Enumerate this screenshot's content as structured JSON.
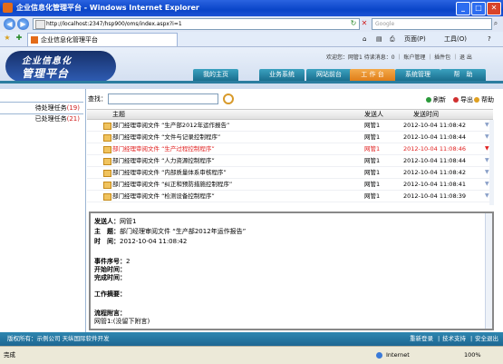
{
  "window": {
    "title": "企业信息化管理平台 - Windows Internet Explorer",
    "min": "_",
    "max": "□",
    "close": "✕"
  },
  "browser": {
    "url": "http://localhost:2347/hsp900/oms/index.aspx?i=1",
    "search_placeholder": "Google",
    "tab_title": "企业信息化管理平台",
    "toolbar": {
      "page": "页面(P)",
      "tools": "工具(O)",
      "help": "?"
    }
  },
  "app": {
    "logo_line1": "企业信息化",
    "logo_line2": "管理平台",
    "welcome": "欢迎您：网管1 待读消息：0 ｜ 账户管理 ｜ 插件包 ｜ 退 出",
    "nav": [
      "我的主页",
      "业务系统",
      "网站前台",
      "工 作 台",
      "系统管理",
      "帮　助"
    ]
  },
  "left_panel": {
    "items": [
      {
        "label": "待处理任务",
        "count": "(19)"
      },
      {
        "label": "已处理任务",
        "count": "(21)"
      }
    ]
  },
  "content": {
    "search_label": "查找：",
    "tools": [
      "刷新",
      "导出",
      "帮助"
    ],
    "columns": [
      "主题",
      "发送人",
      "发送时间"
    ],
    "rows": [
      {
        "subject": "部门经理审阅文件 “生产部2012年运作报告”",
        "sender": "网管1",
        "time": "2012-10-04 11:08:42",
        "highlight": false
      },
      {
        "subject": "部门经理审阅文件 “文件与记录控制程序”",
        "sender": "网管1",
        "time": "2012-10-04 11:08:44",
        "highlight": false
      },
      {
        "subject": "部门经理审阅文件 “生产过程控制程序”",
        "sender": "网管1",
        "time": "2012-10-04 11:08:46",
        "highlight": true
      },
      {
        "subject": "部门经理审阅文件 “人力资源控制程序”",
        "sender": "网管1",
        "time": "2012-10-04 11:08:44",
        "highlight": false
      },
      {
        "subject": "部门经理审阅文件 “内部质量体系审核程序”",
        "sender": "网管1",
        "time": "2012-10-04 11:08:42",
        "highlight": false
      },
      {
        "subject": "部门经理审阅文件 “纠正和预防措施控制程序”",
        "sender": "网管1",
        "time": "2012-10-04 11:08:41",
        "highlight": false
      },
      {
        "subject": "部门经理审阅文件 “检测设备控制程序”",
        "sender": "网管1",
        "time": "2012-10-04 11:08:39",
        "highlight": false
      }
    ]
  },
  "detail": {
    "sender_label": "发送人：",
    "sender": "网管1",
    "subject_label": "主　题：",
    "subject": "部门经理审阅文件 “生产部2012年运作报告”",
    "time_label": "时　间：",
    "time": "2012-10-04 11:08:42",
    "seq_label": "事件序号：",
    "seq": "2",
    "start_label": "开始时间：",
    "finish_label": "完成时间：",
    "summary_label": "工作摘要：",
    "note_label": "流程附言：",
    "note": "网管1:(没留下附言)"
  },
  "footer": {
    "copyright": "版权所有：示例公司  天纵国际软件开发",
    "links": [
      "重新登录",
      "技术支持",
      "安全退出"
    ]
  },
  "status": {
    "done": "完成",
    "zone": "Internet",
    "zoom": "100%"
  }
}
